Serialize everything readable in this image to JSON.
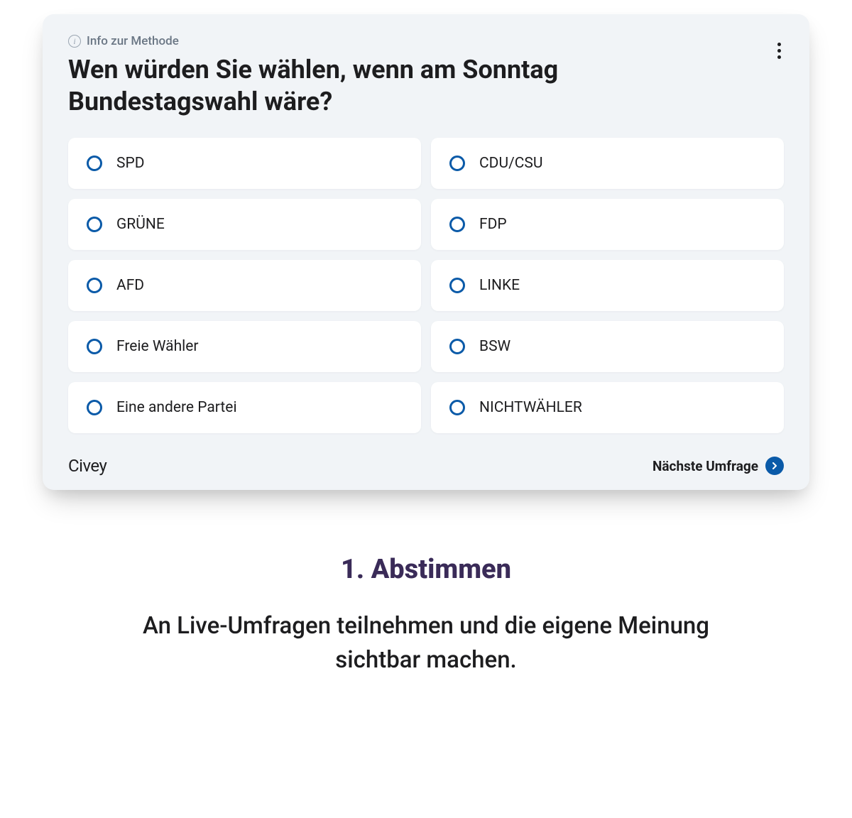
{
  "card": {
    "info_label": "Info zur Methode",
    "question": "Wen würden Sie wählen, wenn am Sonntag Bundestagswahl wäre?",
    "options": [
      "SPD",
      "CDU/CSU",
      "GRÜNE",
      "FDP",
      "AFD",
      "LINKE",
      "Freie Wähler",
      "BSW",
      "Eine andere Partei",
      "NICHTWÄHLER"
    ],
    "brand": "Civey",
    "next_label": "Nächste Umfrage"
  },
  "step": {
    "heading": "1.  Abstimmen",
    "description": "An Live-Umfragen teilnehmen und die eigene Meinung sichtbar machen."
  }
}
